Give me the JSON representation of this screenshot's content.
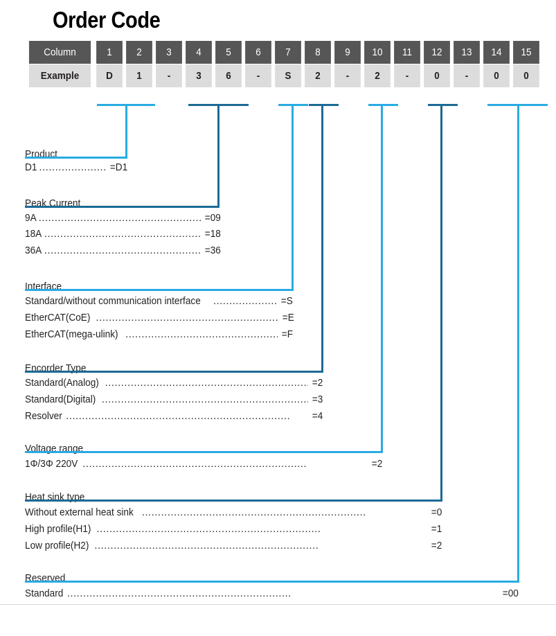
{
  "title": "Order Code",
  "table": {
    "row_labels": [
      "Column",
      "Example"
    ],
    "columns": [
      "1",
      "2",
      "3",
      "4",
      "5",
      "6",
      "7",
      "8",
      "9",
      "10",
      "11",
      "12",
      "13",
      "14",
      "15"
    ],
    "example": [
      "D",
      "1",
      "-",
      "3",
      "6",
      "-",
      "S",
      "2",
      "-",
      "2",
      "-",
      "0",
      "-",
      "0",
      "0"
    ]
  },
  "colors": {
    "accent_light": "#29abe2",
    "accent_dark": "#1b6a96",
    "header_bg": "#565656",
    "value_bg": "#dcdcdc"
  },
  "sections": [
    {
      "name": "Product",
      "options": [
        {
          "label": "D1",
          "code": "=D1"
        }
      ]
    },
    {
      "name": "Peak Current",
      "options": [
        {
          "label": "9A",
          "code": "=09"
        },
        {
          "label": "18A",
          "code": "=18"
        },
        {
          "label": "36A",
          "code": "=36"
        }
      ]
    },
    {
      "name": "Interface",
      "options": [
        {
          "label": "Standard/without communication interface",
          "code": "=S"
        },
        {
          "label": "EtherCAT(CoE)",
          "code": "=E"
        },
        {
          "label": "EtherCAT(mega-ulink)",
          "code": "=F"
        }
      ]
    },
    {
      "name": "Encorder Type",
      "options": [
        {
          "label": "Standard(Analog)",
          "code": "=2"
        },
        {
          "label": "Standard(Digital)",
          "code": "=3"
        },
        {
          "label": "Resolver",
          "code": "=4"
        }
      ]
    },
    {
      "name": "Voltage range",
      "options": [
        {
          "label": "1Φ/3Φ 220V",
          "code": "=2"
        }
      ]
    },
    {
      "name": "Heat sink type",
      "options": [
        {
          "label": "Without external heat sink",
          "code": "=0"
        },
        {
          "label": "High profile(H1)",
          "code": "=1"
        },
        {
          "label": "Low profile(H2)",
          "code": "=2"
        }
      ]
    },
    {
      "name": "Reserved",
      "options": [
        {
          "label": "Standard",
          "code": "=00"
        }
      ]
    }
  ],
  "connectors": [
    {
      "target_section": "Product",
      "columns": "1-2",
      "color": "light"
    },
    {
      "target_section": "Peak Current",
      "columns": "4-5",
      "color": "dark"
    },
    {
      "target_section": "Interface",
      "columns": "7",
      "color": "light"
    },
    {
      "target_section": "Encorder Type",
      "columns": "8",
      "color": "dark"
    },
    {
      "target_section": "Voltage range",
      "columns": "10",
      "color": "light"
    },
    {
      "target_section": "Heat sink type",
      "columns": "12",
      "color": "dark"
    },
    {
      "target_section": "Reserved",
      "columns": "14-15",
      "color": "light"
    }
  ]
}
